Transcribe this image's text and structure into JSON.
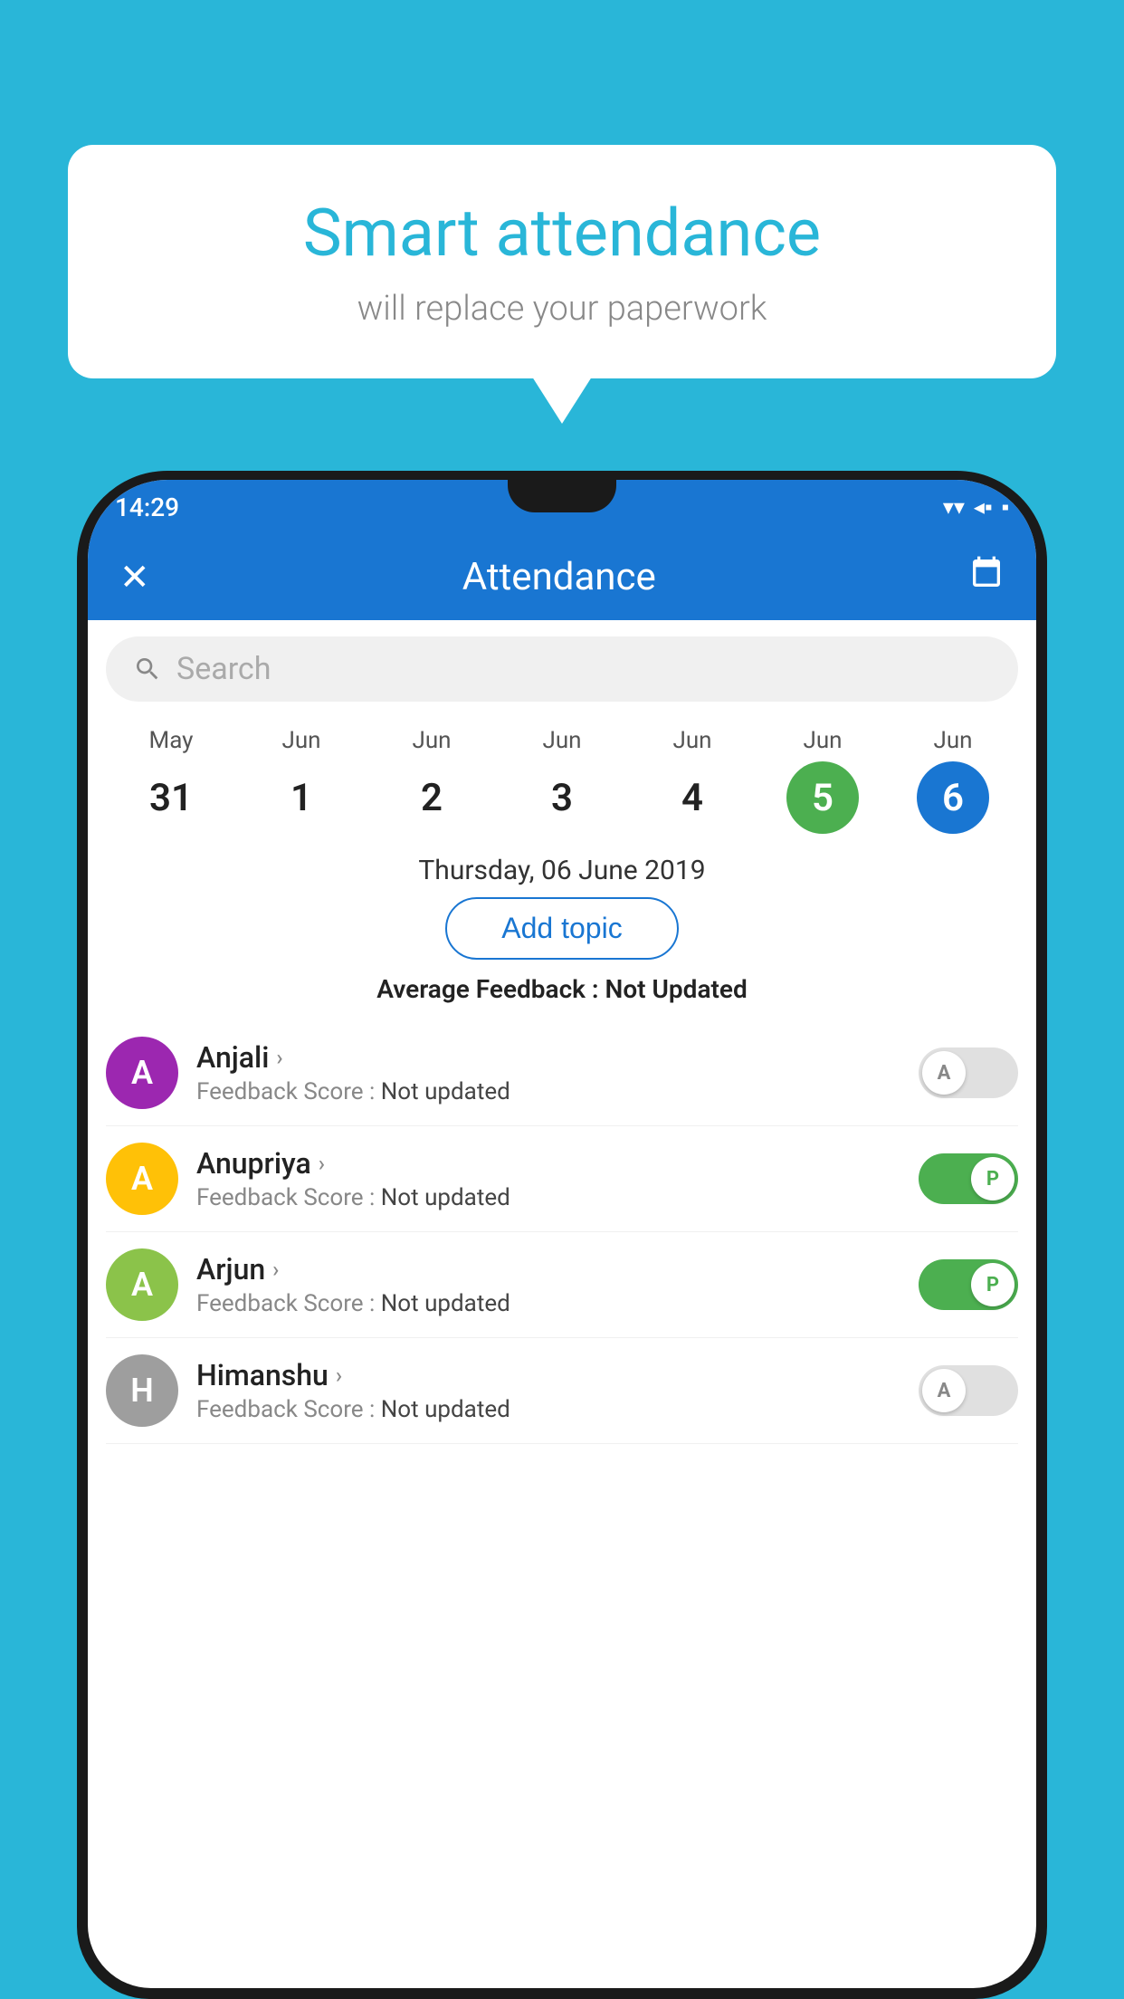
{
  "background_color": "#29B6D8",
  "bubble": {
    "title": "Smart attendance",
    "subtitle": "will replace your paperwork"
  },
  "status_bar": {
    "time": "14:29",
    "wifi_icon": "▼",
    "signal_icon": "▲",
    "battery_icon": "▪"
  },
  "header": {
    "title": "Attendance",
    "close_label": "✕",
    "calendar_icon": "📅"
  },
  "search": {
    "placeholder": "Search"
  },
  "calendar": {
    "days": [
      {
        "month": "May",
        "date": "31",
        "state": "normal"
      },
      {
        "month": "Jun",
        "date": "1",
        "state": "normal"
      },
      {
        "month": "Jun",
        "date": "2",
        "state": "normal"
      },
      {
        "month": "Jun",
        "date": "3",
        "state": "normal"
      },
      {
        "month": "Jun",
        "date": "4",
        "state": "normal"
      },
      {
        "month": "Jun",
        "date": "5",
        "state": "today"
      },
      {
        "month": "Jun",
        "date": "6",
        "state": "selected"
      }
    ],
    "selected_date_label": "Thursday, 06 June 2019"
  },
  "add_topic_label": "Add topic",
  "avg_feedback": {
    "label": "Average Feedback : ",
    "value": "Not Updated"
  },
  "students": [
    {
      "name": "Anjali",
      "avatar_letter": "A",
      "avatar_color": "#9C27B0",
      "feedback_label": "Feedback Score : ",
      "feedback_value": "Not updated",
      "toggle_state": "off",
      "toggle_letter": "A"
    },
    {
      "name": "Anupriya",
      "avatar_letter": "A",
      "avatar_color": "#FFC107",
      "feedback_label": "Feedback Score : ",
      "feedback_value": "Not updated",
      "toggle_state": "on",
      "toggle_letter": "P"
    },
    {
      "name": "Arjun",
      "avatar_letter": "A",
      "avatar_color": "#8BC34A",
      "feedback_label": "Feedback Score : ",
      "feedback_value": "Not updated",
      "toggle_state": "on",
      "toggle_letter": "P"
    },
    {
      "name": "Himanshu",
      "avatar_letter": "H",
      "avatar_color": "#9E9E9E",
      "feedback_label": "Feedback Score : ",
      "feedback_value": "Not updated",
      "toggle_state": "off",
      "toggle_letter": "A"
    }
  ]
}
